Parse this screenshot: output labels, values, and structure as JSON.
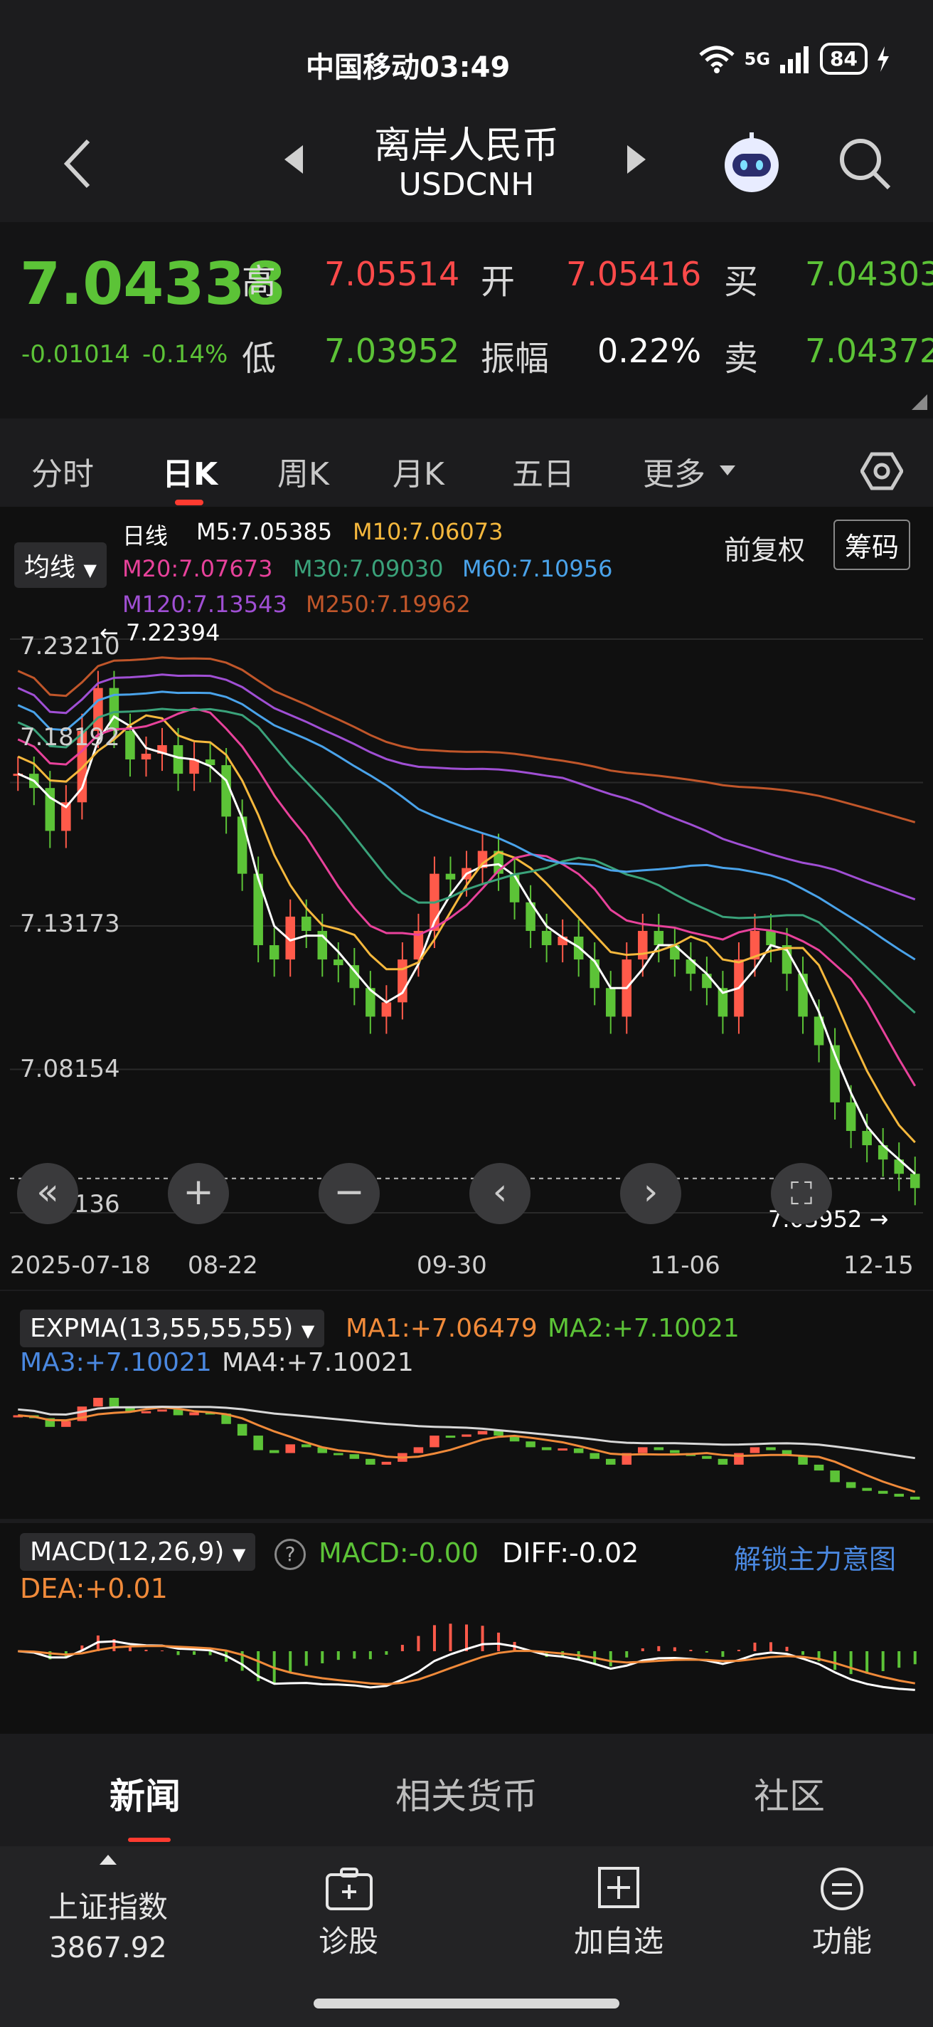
{
  "status_bar": {
    "carrier_time": "中国移动03:49",
    "network": "5G",
    "battery": "84"
  },
  "header": {
    "title": "离岸人民币",
    "subtitle": "USDCNH"
  },
  "quote": {
    "price": "7.04338",
    "change": "-0.01014",
    "change_pct": "-0.14%",
    "high_label": "高",
    "high": "7.05514",
    "low_label": "低",
    "low": "7.03952",
    "open_label": "开",
    "open": "7.05416",
    "amplitude_label": "振幅",
    "amplitude": "0.22%",
    "buy_label": "买",
    "buy": "7.04303",
    "sell_label": "卖",
    "sell": "7.04372"
  },
  "tabs": [
    "分时",
    "日K",
    "周K",
    "月K",
    "五日",
    "更多"
  ],
  "main_chart": {
    "ma_selector": "均线",
    "line_type": "日线",
    "adjust": "前复权",
    "chips_button": "筹码",
    "ma_labels": [
      {
        "text": "M5:7.05385",
        "color": "#ffffff"
      },
      {
        "text": "M10:7.06073",
        "color": "#f5b83d"
      },
      {
        "text": "M20:7.07673",
        "color": "#e8429b"
      },
      {
        "text": "M30:7.09030",
        "color": "#3aa27a"
      },
      {
        "text": "M60:7.10956",
        "color": "#4aa3ea"
      },
      {
        "text": "M120:7.13543",
        "color": "#a04fd4"
      },
      {
        "text": "M250:7.19962",
        "color": "#c0562a"
      }
    ],
    "y_ticks": [
      "7.23210",
      "7.18192",
      "7.13173",
      "7.08154",
      "7.03136"
    ],
    "max_marker": "7.22394",
    "min_marker": "7.03952",
    "x_ticks": [
      "2025-07-18",
      "08-22",
      "09-30",
      "11-06",
      "12-15"
    ]
  },
  "expma": {
    "title": "EXPMA(13,55,55,55)",
    "ma1": "MA1:+7.06479",
    "ma2": "MA2:+7.10021",
    "ma3": "MA3:+7.10021",
    "ma4": "MA4:+7.10021"
  },
  "macd": {
    "title": "MACD(12,26,9)",
    "macd": "MACD:-0.00",
    "diff": "DIFF:-0.02",
    "dea": "DEA:+0.01",
    "unlock": "解锁主力意图"
  },
  "news_tabs": [
    "新闻",
    "相关货币",
    "社区"
  ],
  "bottom_bar": {
    "index_name": "上证指数",
    "index_value": "3867.92",
    "diagnose": "诊股",
    "add_watch": "加自选",
    "functions": "功能"
  },
  "chart_data": {
    "type": "candlestick",
    "y_range": [
      7.03136,
      7.2321
    ],
    "x_labels": [
      "2025-07-18",
      "08-22",
      "09-30",
      "11-06",
      "12-15"
    ],
    "close_trend": [
      7.185,
      7.18,
      7.165,
      7.175,
      7.2,
      7.215,
      7.2,
      7.19,
      7.192,
      7.195,
      7.185,
      7.19,
      7.188,
      7.17,
      7.15,
      7.125,
      7.12,
      7.135,
      7.13,
      7.12,
      7.118,
      7.11,
      7.1,
      7.105,
      7.12,
      7.13,
      7.15,
      7.148,
      7.152,
      7.158,
      7.15,
      7.14,
      7.13,
      7.125,
      7.128,
      7.12,
      7.11,
      7.1,
      7.12,
      7.13,
      7.125,
      7.12,
      7.115,
      7.11,
      7.1,
      7.12,
      7.13,
      7.125,
      7.115,
      7.1,
      7.09,
      7.07,
      7.06,
      7.055,
      7.05,
      7.045,
      7.04
    ]
  }
}
